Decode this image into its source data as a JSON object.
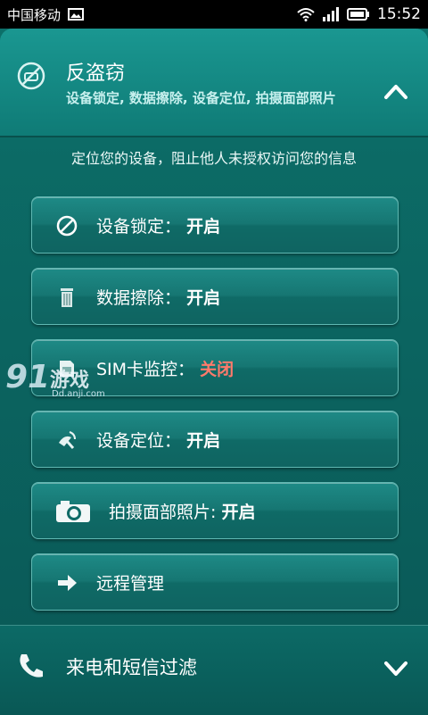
{
  "status": {
    "carrier": "中国移动",
    "time": "15:52"
  },
  "header": {
    "title": "反盗窃",
    "subtitle": "设备锁定, 数据擦除, 设备定位, 拍摄面部照片"
  },
  "intro": "定位您的设备，阻止他人未授权访问您的信息",
  "items": [
    {
      "label": "设备锁定：",
      "value": "开启",
      "icon": "no-entry-icon"
    },
    {
      "label": "数据擦除：",
      "value": "开启",
      "icon": "trash-icon"
    },
    {
      "label": "SIM卡监控：",
      "value": "关闭",
      "icon": "sim-icon"
    },
    {
      "label": "设备定位：",
      "value": "开启",
      "icon": "satellite-icon"
    },
    {
      "label": "拍摄面部照片:",
      "value": "开启",
      "icon": "camera-icon"
    },
    {
      "label": "远程管理",
      "value": "",
      "icon": "arrow-right-icon"
    }
  ],
  "footer": {
    "title": "来电和短信过滤"
  },
  "watermark": {
    "num": "91",
    "text": "游戏",
    "url": "Dd.anji.com"
  },
  "colors": {
    "accent": "#1a9791",
    "off_value": "#ff7a6b"
  }
}
